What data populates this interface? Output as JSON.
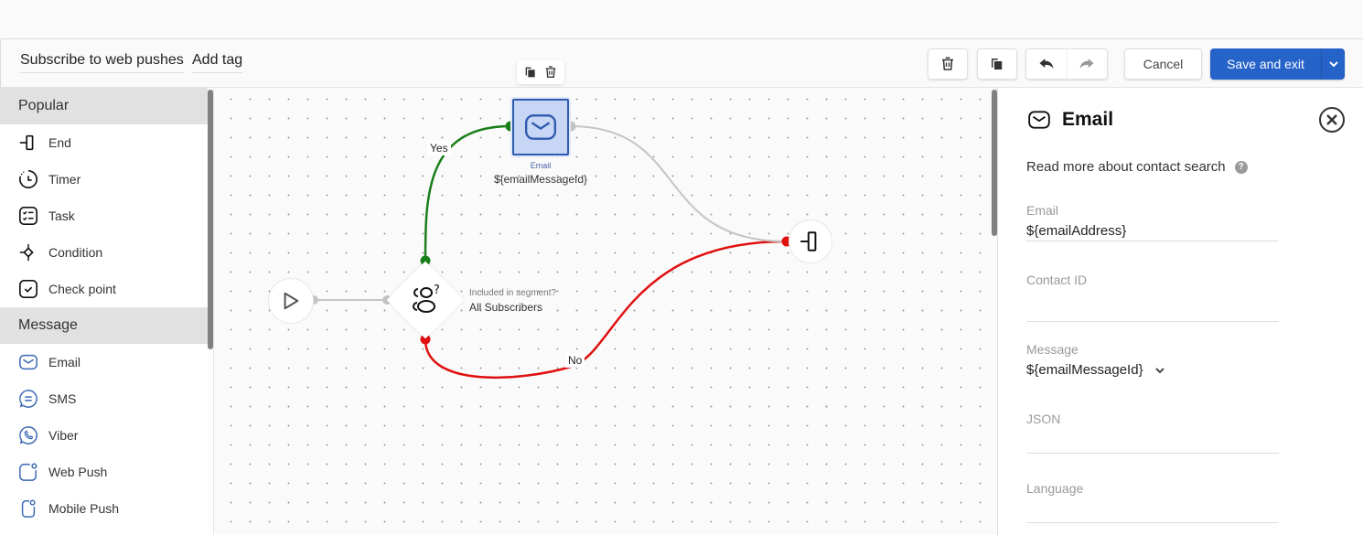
{
  "toolbar": {
    "flow_name": "Subscribe to web pushes",
    "add_tag": "Add tag",
    "cancel_label": "Cancel",
    "save_label": "Save and exit"
  },
  "sidebar": {
    "sections": [
      {
        "title": "Popular",
        "items": [
          {
            "label": "End",
            "icon": "end-icon"
          },
          {
            "label": "Timer",
            "icon": "timer-icon"
          },
          {
            "label": "Task",
            "icon": "task-icon"
          },
          {
            "label": "Condition",
            "icon": "condition-icon"
          },
          {
            "label": "Check point",
            "icon": "check-point-icon"
          }
        ]
      },
      {
        "title": "Message",
        "items": [
          {
            "label": "Email",
            "icon": "email-icon"
          },
          {
            "label": "SMS",
            "icon": "sms-icon"
          },
          {
            "label": "Viber",
            "icon": "viber-icon"
          },
          {
            "label": "Web Push",
            "icon": "web-push-icon"
          },
          {
            "label": "Mobile Push",
            "icon": "mobile-push-icon"
          }
        ]
      }
    ]
  },
  "canvas": {
    "condition_node": {
      "caption": "Included in segment?",
      "value": "All Subscribers"
    },
    "email_node": {
      "caption": "Email",
      "value": "${emailMessageId}"
    },
    "edge_yes": "Yes",
    "edge_no": "No",
    "colors": {
      "yes": "#1a7f1a",
      "no": "#e01010",
      "neutral": "#c4c4c4",
      "selected_fill": "#c7d6f4",
      "selected_border": "#2f5bb0"
    }
  },
  "panel": {
    "title": "Email",
    "help_text": "Read more about contact search",
    "fields": {
      "email": {
        "label": "Email",
        "value": "${emailAddress}"
      },
      "contact_id": {
        "label": "Contact ID",
        "value": ""
      },
      "message": {
        "label": "Message",
        "value": "${emailMessageId}"
      },
      "json": {
        "label": "JSON",
        "value": ""
      },
      "language": {
        "label": "Language",
        "value": ""
      }
    }
  },
  "accent_color": "#2563c9"
}
